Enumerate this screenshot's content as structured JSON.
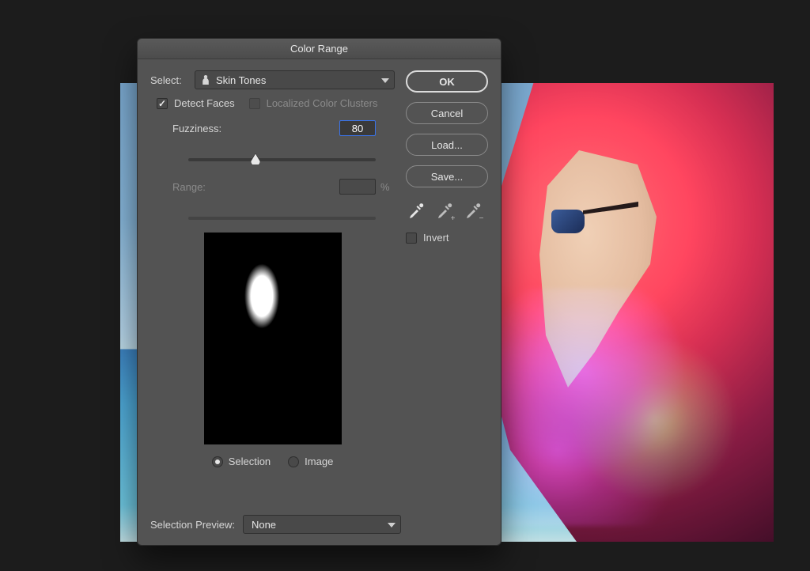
{
  "dialog": {
    "title": "Color Range",
    "select_label": "Select:",
    "select_value": "Skin Tones",
    "detect_faces_label": "Detect Faces",
    "detect_faces_checked": true,
    "localized_clusters_label": "Localized Color Clusters",
    "localized_clusters_enabled": false,
    "fuzziness_label": "Fuzziness:",
    "fuzziness_value": "80",
    "fuzziness_slider_pct": 36,
    "range_label": "Range:",
    "range_unit": "%",
    "preview_mode_selection": "Selection",
    "preview_mode_image": "Image",
    "preview_mode_value": "Selection"
  },
  "buttons": {
    "ok": "OK",
    "cancel": "Cancel",
    "load": "Load...",
    "save": "Save...",
    "invert": "Invert"
  },
  "footer": {
    "selection_preview_label": "Selection Preview:",
    "selection_preview_value": "None"
  }
}
